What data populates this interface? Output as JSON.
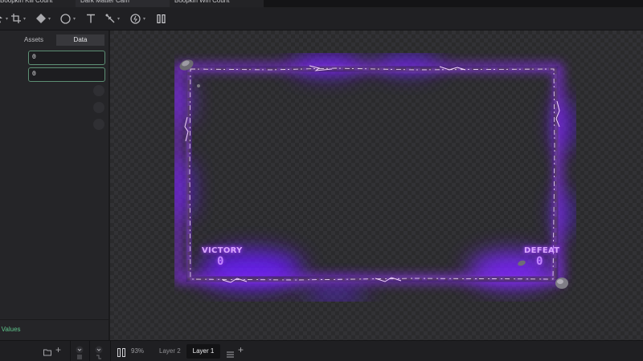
{
  "tabs": [
    {
      "label": "Boopkin Kill Count",
      "active": false
    },
    {
      "label": "Dark Matter Cam",
      "active": true
    },
    {
      "label": "Boopkin Win Count",
      "active": false
    }
  ],
  "tab_close_glyph": "×",
  "toolbar": {
    "tools": [
      "move-icon",
      "crop-icon",
      "component-icon",
      "ellipse-icon",
      "text-icon",
      "pen-icon",
      "timer-icon",
      "columns-icon"
    ]
  },
  "left_panel": {
    "tabs": {
      "assets": "Assets",
      "data": "Data"
    },
    "fields": [
      {
        "value": "0"
      },
      {
        "value": "0"
      }
    ],
    "footer_link": "ce Values",
    "accent_color": "#5fc48c"
  },
  "canvas": {
    "overlay": {
      "victory_label": "VICTORY",
      "victory_count": "0",
      "defeat_label": "DEFEAT",
      "defeat_count": "0",
      "glow_color": "#8a2bff"
    }
  },
  "bottom_bar": {
    "zoom": "93%",
    "layers": [
      {
        "label": "Layer 2",
        "active": false
      },
      {
        "label": "Layer 1",
        "active": true
      }
    ]
  }
}
